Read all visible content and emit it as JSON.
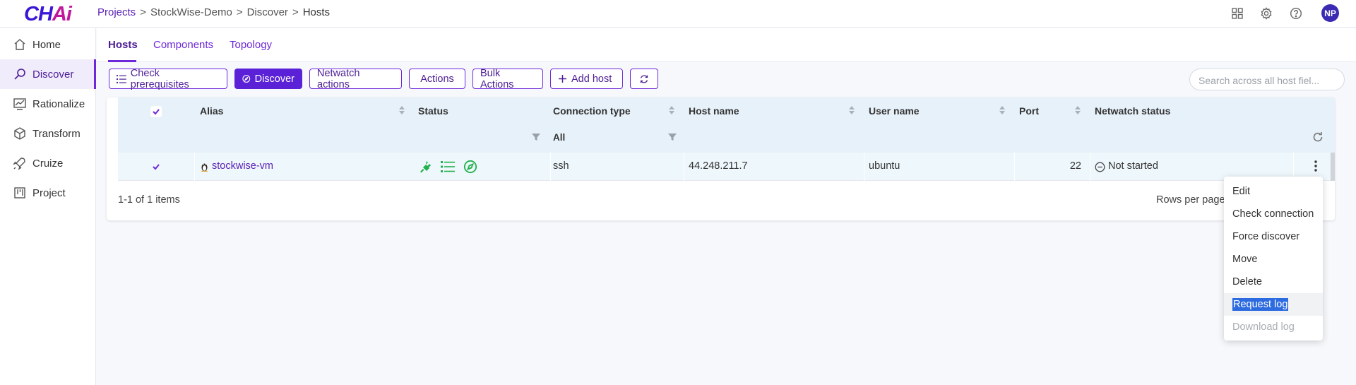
{
  "header": {
    "logo": {
      "part1": "CH",
      "part2": "Ai"
    },
    "breadcrumb": [
      "Projects",
      "StockWise-Demo",
      "Discover",
      "Hosts"
    ],
    "avatar": "NP",
    "icons": [
      "apps-grid-icon",
      "gear-icon",
      "help-icon"
    ]
  },
  "sidebar": {
    "items": [
      {
        "label": "Home",
        "icon": "home-icon"
      },
      {
        "label": "Discover",
        "icon": "discover-icon",
        "active": true
      },
      {
        "label": "Rationalize",
        "icon": "chart-icon"
      },
      {
        "label": "Transform",
        "icon": "cube-icon"
      },
      {
        "label": "Cruize",
        "icon": "rocket-icon"
      },
      {
        "label": "Project",
        "icon": "kanban-icon"
      }
    ]
  },
  "tabs": [
    {
      "label": "Hosts",
      "active": true
    },
    {
      "label": "Components"
    },
    {
      "label": "Topology"
    }
  ],
  "toolbar": {
    "check_prerequisites": "Check prerequisites",
    "discover": "Discover",
    "netwatch_actions": "Netwatch actions",
    "actions": "Actions",
    "bulk_actions": "Bulk Actions",
    "add_host": "Add host",
    "search_placeholder": "Search across all host fiel..."
  },
  "grid": {
    "columns": [
      "Alias",
      "Status",
      "Connection type",
      "Host name",
      "User name",
      "Port",
      "Netwatch status"
    ],
    "connection_filter": "All",
    "rows": [
      {
        "alias": "stockwise-vm",
        "connection_type": "ssh",
        "host_name": "44.248.211.7",
        "user_name": "ubuntu",
        "port": "22",
        "netwatch_status": "Not started"
      }
    ],
    "footer_count": "1-1 of 1 items",
    "rows_per_page": "Rows per page"
  },
  "context_menu": {
    "items": [
      "Edit",
      "Check connection",
      "Force discover",
      "Move",
      "Delete",
      "Request log",
      "Download log"
    ]
  },
  "colors": {
    "accent": "#6d28d9",
    "status_green": "#22b14c"
  }
}
